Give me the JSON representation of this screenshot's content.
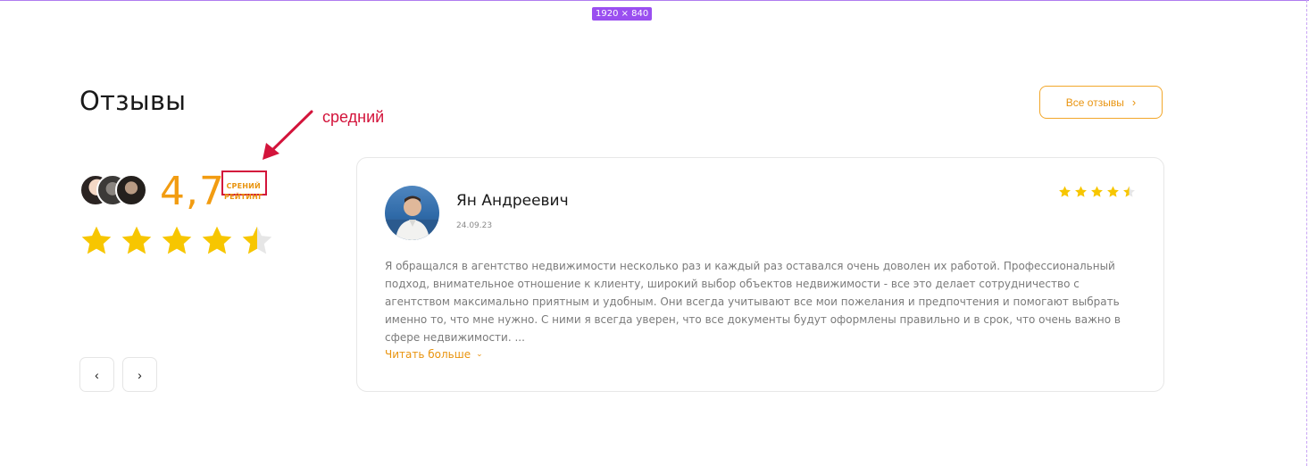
{
  "design_tool": {
    "frame_size_badge": "1920 × 840",
    "accent": "#9a4ff0"
  },
  "section": {
    "title": "Отзывы",
    "all_reviews_label": "Все отзывы",
    "all_reviews_icon": "chevron-right-icon"
  },
  "annotation": {
    "text": "средний",
    "color": "#d3143b"
  },
  "summary": {
    "rating": "4,7",
    "rating_value": 4.7,
    "caption_line1": "СРЕНИЙ",
    "caption_line2": "РЕЙТИНГ",
    "stars_filled": 4.5,
    "stars_total": 5,
    "avatar_count": 3
  },
  "carousel": {
    "prev_icon": "chevron-left-icon",
    "next_icon": "chevron-right-icon",
    "prev_symbol": "‹",
    "next_symbol": "›"
  },
  "review": {
    "author": "Ян Андреевич",
    "date": "24.09.23",
    "stars_filled": 4.5,
    "stars_total": 5,
    "text": "Я обращался в агентство недвижимости несколько раз и каждый раз оставался очень доволен их работой. Профессиональный подход, внимательное отношение к клиенту, широкий выбор объектов недвижимости - все это делает сотрудничество с агентством максимально приятным и удобным. Они всегда учитывают все мои пожелания и предпочтения и помогают выбрать именно то, что мне нужно. С ними я всегда уверен, что все документы будут оформлены правильно и в срок, что очень важно в сфере недвижимости. ...",
    "read_more_label": "Читать больше",
    "read_more_icon": "chevron-down-icon"
  },
  "colors": {
    "brand_orange": "#f29c11",
    "star_gold": "#f7c600",
    "star_empty": "#e6e6e6",
    "border": "#e7e7e7"
  }
}
